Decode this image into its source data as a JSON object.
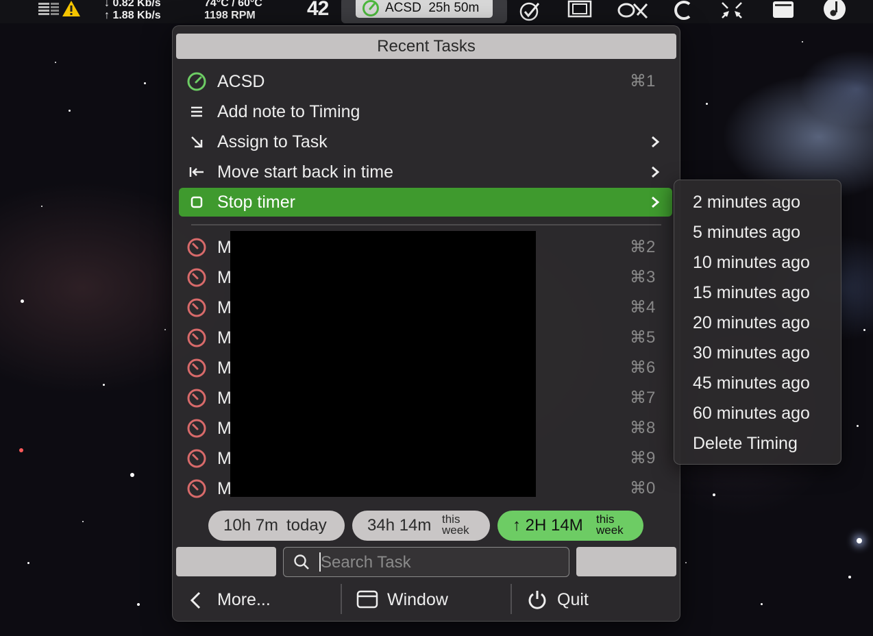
{
  "menubar": {
    "net_down": "↓ 0.82 Kb/s",
    "net_up": "↑ 1.88 Kb/s",
    "temps": "74°C / 60°C",
    "fan": "1198 RPM",
    "counter": "42",
    "timer_task": "ACSD",
    "timer_elapsed": "25h 50m"
  },
  "menu": {
    "header": "Recent Tasks",
    "current": {
      "label": "ACSD",
      "shortcut": "⌘1"
    },
    "actions": [
      {
        "label": "Add note to Timing",
        "icon": "list-icon"
      },
      {
        "label": "Assign to Task",
        "icon": "arrow-down-right-icon"
      },
      {
        "label": "Move start back in time",
        "icon": "arrow-left-to-line-icon"
      },
      {
        "label": "Stop timer",
        "icon": "stop-square-icon"
      }
    ],
    "recent": [
      {
        "label": "M",
        "shortcut": "⌘2"
      },
      {
        "label": "M",
        "shortcut": "⌘3"
      },
      {
        "label": "M",
        "shortcut": "⌘4"
      },
      {
        "label": "M",
        "shortcut": "⌘5"
      },
      {
        "label": "M",
        "shortcut": "⌘6"
      },
      {
        "label": "M",
        "shortcut": "⌘7"
      },
      {
        "label": "M",
        "shortcut": "⌘8"
      },
      {
        "label": "M",
        "shortcut": "⌘9"
      },
      {
        "label": "M",
        "shortcut": "⌘0"
      }
    ],
    "stats": {
      "today_value": "10h 7m",
      "today_label": "today",
      "week_value": "34h 14m",
      "week_label_1": "this",
      "week_label_2": "week",
      "delta_value": "↑ 2H 14M",
      "delta_label_1": "this",
      "delta_label_2": "week"
    },
    "search_placeholder": "Search Task",
    "bottom": {
      "more": "More...",
      "window": "Window",
      "quit": "Quit"
    },
    "colors": {
      "highlight": "#3f9a2e",
      "current_task": "#6dcc64",
      "recent_task": "#d86a6a"
    }
  },
  "submenu": {
    "items": [
      "2 minutes ago",
      "5 minutes ago",
      "10 minutes ago",
      "15 minutes ago",
      "20 minutes ago",
      "30 minutes ago",
      "45 minutes ago",
      "60 minutes ago",
      "Delete Timing"
    ]
  }
}
